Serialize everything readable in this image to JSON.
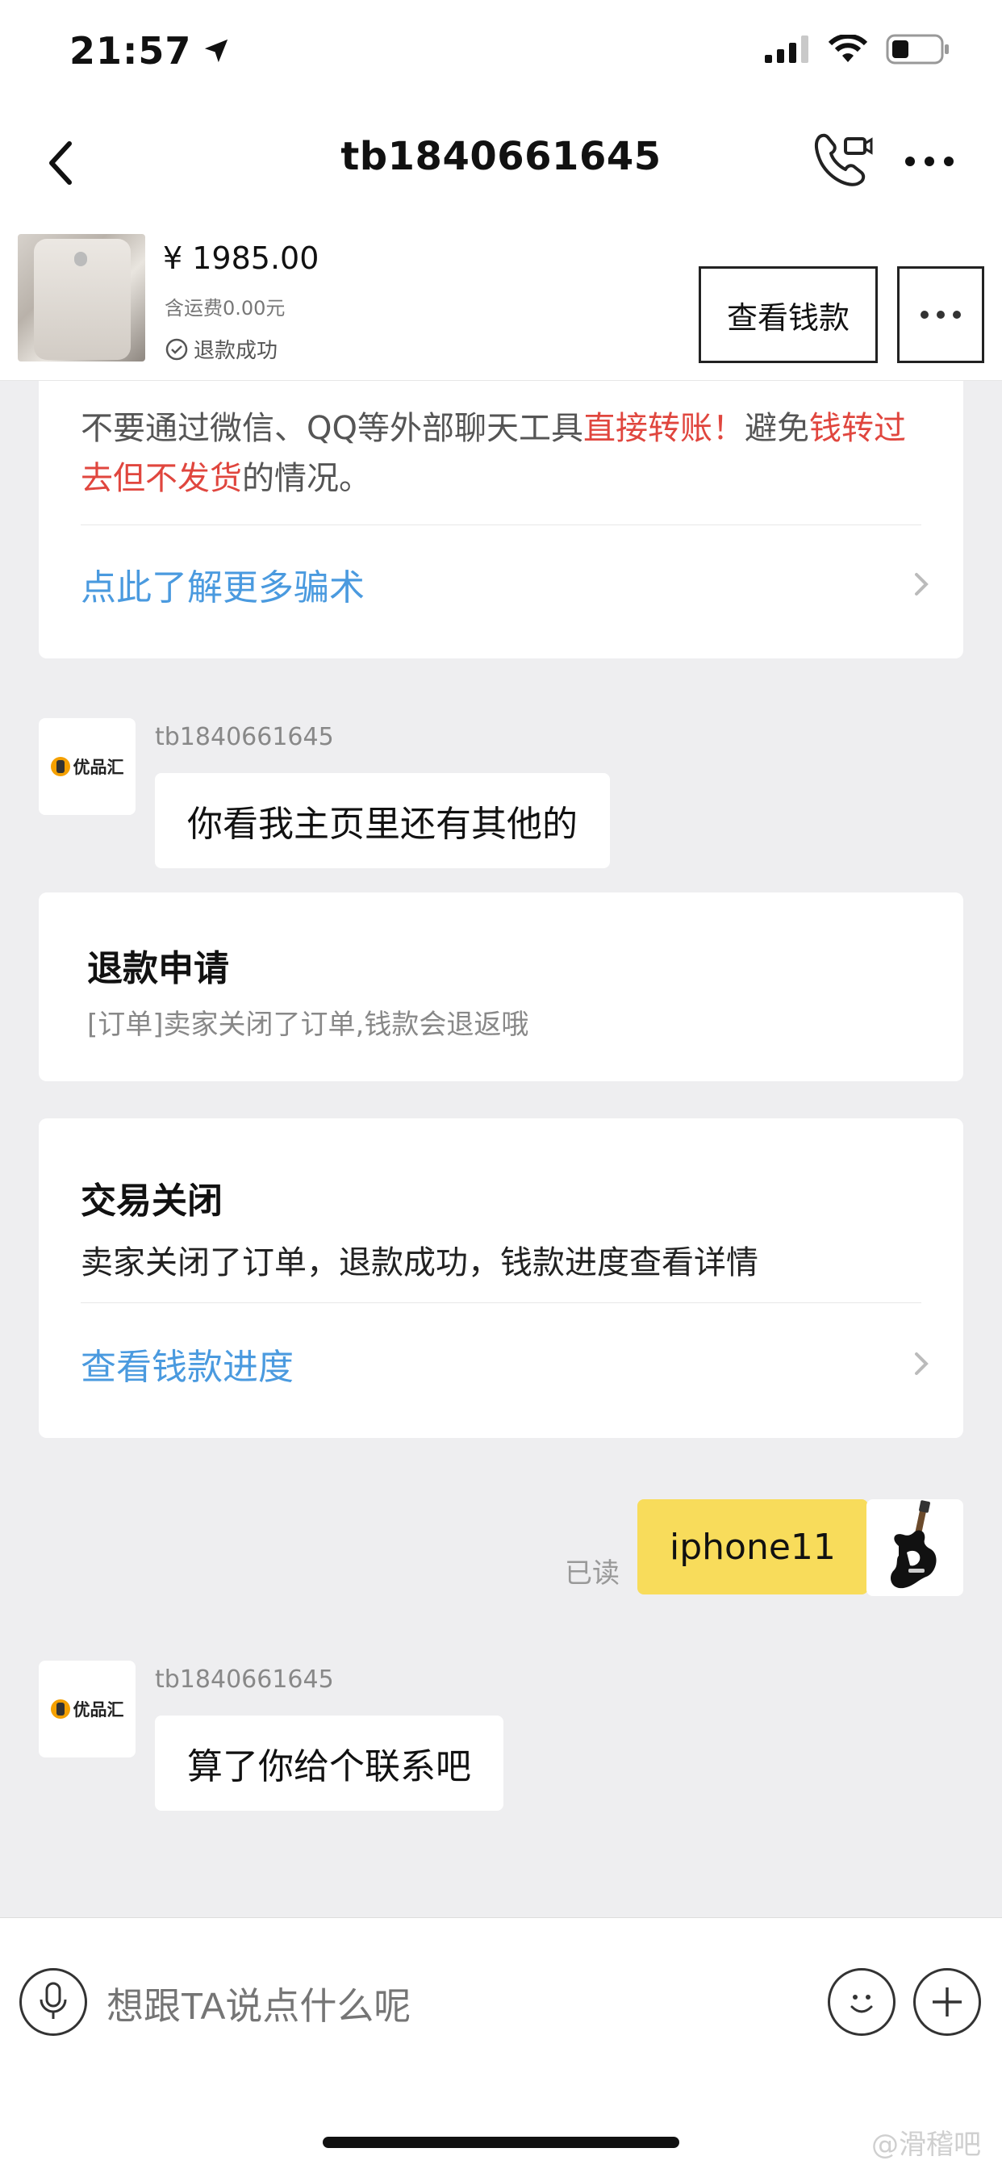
{
  "status_bar": {
    "time": "21:57"
  },
  "nav": {
    "title": "tb1840661645"
  },
  "product": {
    "price": "¥ 1985.00",
    "shipping": "含运费0.00元",
    "status": "退款成功",
    "view_money_label": "查看钱款"
  },
  "warning": {
    "text_1": "不要通过微信、QQ等外部聊天工具",
    "text_red_1": "直接转账！",
    "text_2": "避免",
    "text_red_2": "钱转过去但不发货",
    "text_3": "的情况。",
    "link": "点此了解更多骗术"
  },
  "messages": [
    {
      "sender": "tb1840661645",
      "text": "你看我主页里还有其他的"
    },
    {
      "sender": "tb1840661645",
      "text": "算了你给个联系吧"
    }
  ],
  "refund_card": {
    "title": "退款申请",
    "desc": "[订单]卖家关闭了订单,钱款会退返哦"
  },
  "closed_card": {
    "title": "交易关闭",
    "desc": "卖家关闭了订单，退款成功，钱款进度查看详情",
    "link": "查看钱款进度"
  },
  "my_message": {
    "text": "iphone11",
    "read": "已读"
  },
  "avatar_brand": "优品汇",
  "input": {
    "placeholder": "想跟TA说点什么呢"
  },
  "watermark": "@滑稽吧",
  "colors": {
    "accent_yellow": "#F8DC5B",
    "link_blue": "#4A9ADF",
    "warn_red": "#E0463E"
  }
}
